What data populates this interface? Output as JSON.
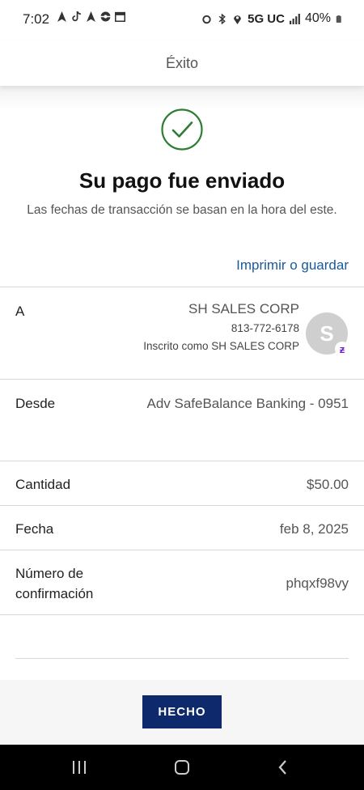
{
  "status_bar": {
    "time": "7:02",
    "network": "5G UC",
    "battery": "40%",
    "left_icons": [
      "navigation-icon",
      "tiktok-icon",
      "navigation-icon",
      "pokeball-icon",
      "calendar-icon"
    ],
    "right_icons": [
      "alarm-icon",
      "bluetooth-icon",
      "location-icon",
      "signal-icon",
      "battery-icon"
    ]
  },
  "header": {
    "title": "Éxito"
  },
  "confirmation": {
    "icon": "check-circle-icon",
    "icon_color": "#2e7d32",
    "headline": "Su pago fue enviado",
    "subtext": "Las fechas de transacción se basan en la hora del este.",
    "print_link": "Imprimir o guardar"
  },
  "details": {
    "to": {
      "label": "A",
      "name": "SH SALES CORP",
      "phone": "813-772-6178",
      "enrolled": "Inscrito como SH SALES CORP",
      "avatar_letter": "S",
      "badge": "zelle-icon"
    },
    "from": {
      "label": "Desde",
      "value": "Adv SafeBalance Banking - 0951"
    },
    "amount": {
      "label": "Cantidad",
      "value": "$50.00"
    },
    "date": {
      "label": "Fecha",
      "value": "feb 8, 2025"
    },
    "confirmation_number": {
      "label": "Número de confirmación",
      "value": "phqxf98vy"
    }
  },
  "actions": {
    "done_label": "HECHO",
    "done_color": "#0f2a6c"
  },
  "nav_bar": {
    "icons": [
      "recent-apps-icon",
      "home-icon",
      "back-icon"
    ]
  }
}
